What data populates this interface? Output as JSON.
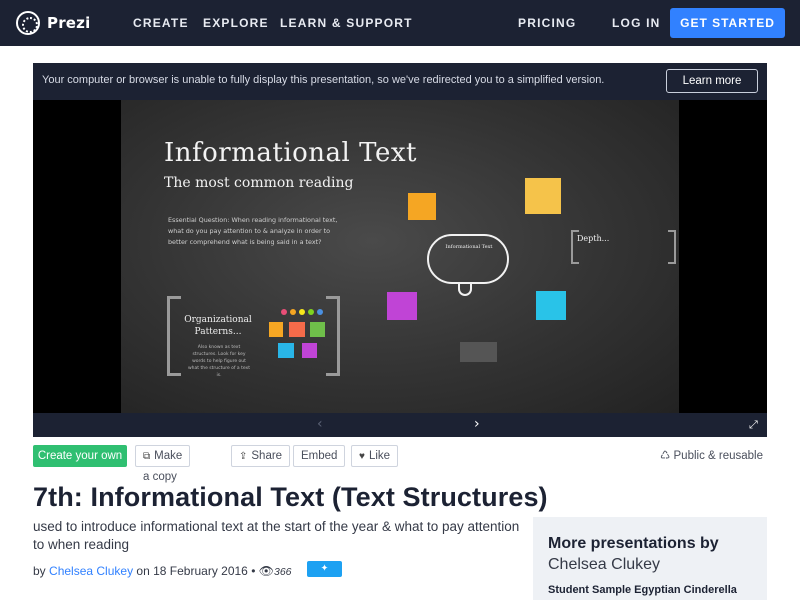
{
  "nav": {
    "logo_text": "Prezi",
    "links": [
      "CREATE",
      "EXPLORE",
      "LEARN & SUPPORT"
    ],
    "pricing": "PRICING",
    "login": "LOG IN",
    "cta": "GET STARTED"
  },
  "player": {
    "banner_text": "Your computer or browser is unable to fully display this presentation, so we've redirected you to a simplified version.",
    "learn_more": "Learn more",
    "slide": {
      "title": "Informational Text",
      "subtitle": "The most common reading",
      "question": "Essential Question: When reading informational text, what do you pay attention to & analyze in order to better comprehend what is being said in a text?",
      "patterns_title": "Organizational Patterns...",
      "patterns_text": "Also known as text structures. Look for key words to help figure out what the structure of a text is.",
      "cloud_title": "Informational Text",
      "depth_title": "Depth..."
    }
  },
  "actions": {
    "create": "Create your own",
    "copy": "Make a copy",
    "share": "Share",
    "embed": "Embed",
    "like": "Like",
    "public": "Public & reusable"
  },
  "presentation": {
    "title": "7th: Informational Text (Text Structures)",
    "description": "used to introduce informational text at the start of the year & what to pay attention to when reading",
    "by": "by",
    "author": "Chelsea Clukey",
    "date_prefix": "on",
    "date": "18 February 2016",
    "views": "366",
    "tweet": "Tweet"
  },
  "more": {
    "title": "More presentations by",
    "author": "Chelsea Clukey",
    "first_item": "Student Sample Egyptian Cinderella"
  },
  "colors": {
    "nav_bg": "#1c2233",
    "accent_blue": "#3181ff",
    "green": "#2fbf71"
  }
}
